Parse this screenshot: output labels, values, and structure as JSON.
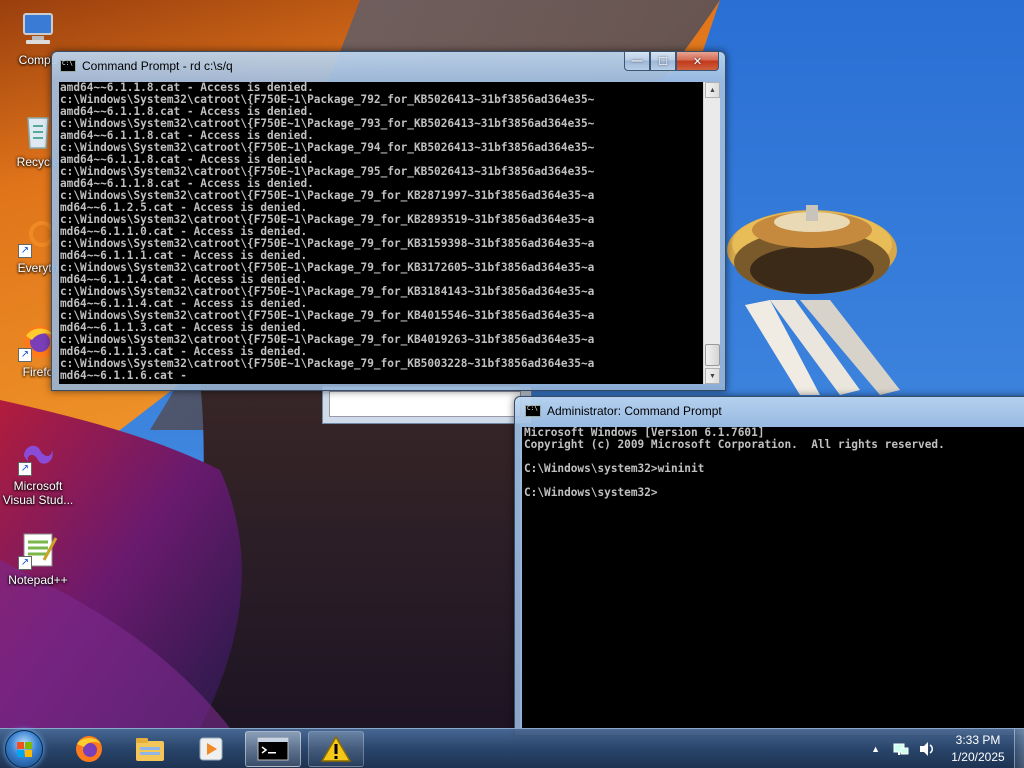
{
  "desktop": {
    "icons": [
      {
        "label": "Compu",
        "icon": "computer-icon"
      },
      {
        "label": "Recycle",
        "icon": "recycle-bin-icon"
      },
      {
        "label": "Everyth",
        "icon": "everything-search-icon"
      },
      {
        "label": "Firefo",
        "icon": "firefox-icon"
      },
      {
        "label": "Microsoft\nVisual Stud...",
        "icon": "visual-studio-icon"
      },
      {
        "label": "Notepad++",
        "icon": "notepad-plus-plus-icon"
      }
    ]
  },
  "window_main": {
    "title": "Command Prompt - rd  c:\\s/q",
    "lines": [
      "amd64~~6.1.1.8.cat - Access is denied.",
      "c:\\Windows\\System32\\catroot\\{F750E~1\\Package_792_for_KB5026413~31bf3856ad364e35~",
      "amd64~~6.1.1.8.cat - Access is denied.",
      "c:\\Windows\\System32\\catroot\\{F750E~1\\Package_793_for_KB5026413~31bf3856ad364e35~",
      "amd64~~6.1.1.8.cat - Access is denied.",
      "c:\\Windows\\System32\\catroot\\{F750E~1\\Package_794_for_KB5026413~31bf3856ad364e35~",
      "amd64~~6.1.1.8.cat - Access is denied.",
      "c:\\Windows\\System32\\catroot\\{F750E~1\\Package_795_for_KB5026413~31bf3856ad364e35~",
      "amd64~~6.1.1.8.cat - Access is denied.",
      "c:\\Windows\\System32\\catroot\\{F750E~1\\Package_79_for_KB2871997~31bf3856ad364e35~a",
      "md64~~6.1.2.5.cat - Access is denied.",
      "c:\\Windows\\System32\\catroot\\{F750E~1\\Package_79_for_KB2893519~31bf3856ad364e35~a",
      "md64~~6.1.1.0.cat - Access is denied.",
      "c:\\Windows\\System32\\catroot\\{F750E~1\\Package_79_for_KB3159398~31bf3856ad364e35~a",
      "md64~~6.1.1.1.cat - Access is denied.",
      "c:\\Windows\\System32\\catroot\\{F750E~1\\Package_79_for_KB3172605~31bf3856ad364e35~a",
      "md64~~6.1.1.4.cat - Access is denied.",
      "c:\\Windows\\System32\\catroot\\{F750E~1\\Package_79_for_KB3184143~31bf3856ad364e35~a",
      "md64~~6.1.1.4.cat - Access is denied.",
      "c:\\Windows\\System32\\catroot\\{F750E~1\\Package_79_for_KB4015546~31bf3856ad364e35~a",
      "md64~~6.1.1.3.cat - Access is denied.",
      "c:\\Windows\\System32\\catroot\\{F750E~1\\Package_79_for_KB4019263~31bf3856ad364e35~a",
      "md64~~6.1.1.3.cat - Access is denied.",
      "c:\\Windows\\System32\\catroot\\{F750E~1\\Package_79_for_KB5003228~31bf3856ad364e35~a",
      "md64~~6.1.1.6.cat -"
    ],
    "scroll_up": "▲",
    "scroll_down": "▼",
    "buttons": {
      "minimize": "—",
      "maximize": "☐",
      "close": "✕"
    }
  },
  "window_admin": {
    "title": "Administrator: Command Prompt",
    "lines": [
      "Microsoft Windows [Version 6.1.7601]",
      "Copyright (c) 2009 Microsoft Corporation.  All rights reserved.",
      "",
      "C:\\Windows\\system32>wininit",
      "",
      "C:\\Windows\\system32>"
    ]
  },
  "taskbar": {
    "start": "start-orb-icon",
    "buttons": [
      "firefox-icon",
      "explorer-icon",
      "media-player-icon",
      "command-prompt-icon",
      "warning-icon"
    ],
    "tray": {
      "show_hidden": "▲"
    },
    "clock": {
      "time": "3:33 PM",
      "date": "1/20/2025"
    }
  },
  "colors": {
    "console_bg": "#000000",
    "console_fg": "#c0c0c0",
    "sky": "#2f78d8"
  }
}
